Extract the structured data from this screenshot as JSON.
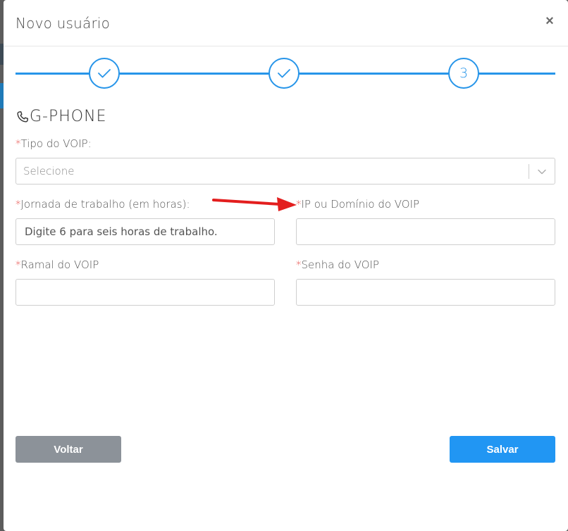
{
  "modal": {
    "title": "Novo usuário",
    "close_label": "×"
  },
  "stepper": {
    "steps": [
      {
        "state": "done"
      },
      {
        "state": "done"
      },
      {
        "state": "current",
        "number": "3"
      }
    ],
    "accent": "#2795e9"
  },
  "section": {
    "icon": "phone-icon",
    "title": "G-PHONE"
  },
  "fields": {
    "voip_type": {
      "required_mark": "*",
      "label": "Tipo do VOIP:",
      "value": "Selecione"
    },
    "workday": {
      "required_mark": "*",
      "label": "Jornada de trabalho (em horas):",
      "value": "",
      "placeholder": "Digite 6 para seis horas de trabalho."
    },
    "voip_host": {
      "required_mark": "*",
      "label": "IP ou Domínio do VOIP",
      "value": ""
    },
    "voip_extension": {
      "required_mark": "*",
      "label": "Ramal do VOIP",
      "value": ""
    },
    "voip_password": {
      "required_mark": "*",
      "label": "Senha do VOIP",
      "value": ""
    }
  },
  "buttons": {
    "back": "Voltar",
    "save": "Salvar"
  },
  "annotation": {
    "arrow_color": "#e31e1e"
  }
}
